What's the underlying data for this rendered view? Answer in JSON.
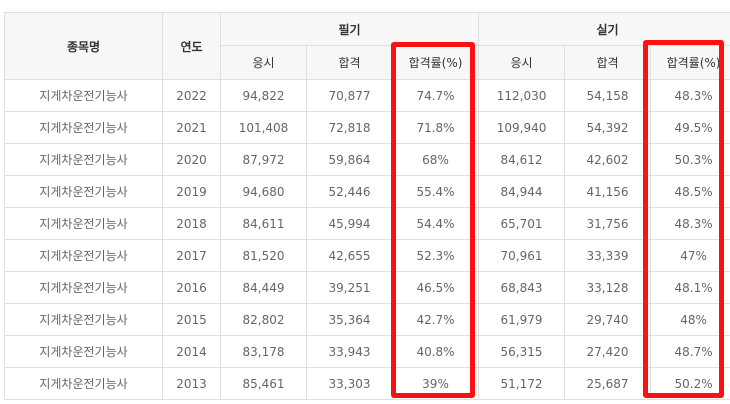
{
  "header": {
    "name": "종목명",
    "year": "연도",
    "written": "필기",
    "practical": "실기",
    "taken": "응시",
    "passed": "합격",
    "rate": "합격률(%)"
  },
  "chart_data": {
    "type": "table",
    "columns": [
      "종목명",
      "연도",
      "필기 응시",
      "필기 합격",
      "필기 합격률(%)",
      "실기 응시",
      "실기 합격",
      "실기 합격률(%)"
    ],
    "rows": [
      [
        "지게차운전기능사",
        "2022",
        "94,822",
        "70,877",
        "74.7%",
        "112,030",
        "54,158",
        "48.3%"
      ],
      [
        "지게차운전기능사",
        "2021",
        "101,408",
        "72,818",
        "71.8%",
        "109,940",
        "54,392",
        "49.5%"
      ],
      [
        "지게차운전기능사",
        "2020",
        "87,972",
        "59,864",
        "68%",
        "84,612",
        "42,602",
        "50.3%"
      ],
      [
        "지게차운전기능사",
        "2019",
        "94,680",
        "52,446",
        "55.4%",
        "84,944",
        "41,156",
        "48.5%"
      ],
      [
        "지게차운전기능사",
        "2018",
        "84,611",
        "45,994",
        "54.4%",
        "65,701",
        "31,756",
        "48.3%"
      ],
      [
        "지게차운전기능사",
        "2017",
        "81,520",
        "42,655",
        "52.3%",
        "70,961",
        "33,339",
        "47%"
      ],
      [
        "지게차운전기능사",
        "2016",
        "84,449",
        "39,251",
        "46.5%",
        "68,843",
        "33,128",
        "48.1%"
      ],
      [
        "지게차운전기능사",
        "2015",
        "82,802",
        "35,364",
        "42.7%",
        "61,979",
        "29,740",
        "48%"
      ],
      [
        "지게차운전기능사",
        "2014",
        "83,178",
        "33,943",
        "40.8%",
        "56,315",
        "27,420",
        "48.7%"
      ],
      [
        "지게차운전기능사",
        "2013",
        "85,461",
        "33,303",
        "39%",
        "51,172",
        "25,687",
        "50.2%"
      ]
    ],
    "highlight_color": "#ff1010"
  }
}
